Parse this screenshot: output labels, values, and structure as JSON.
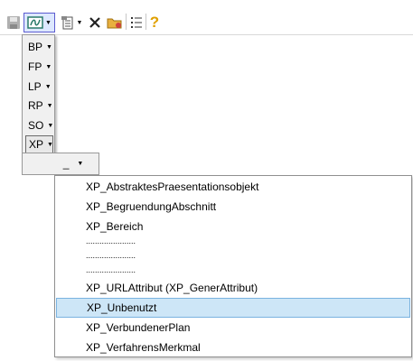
{
  "toolbar": {
    "buttons": [
      {
        "name": "save-icon"
      },
      {
        "name": "xplan-icon",
        "has_dropdown": true,
        "active": true
      },
      {
        "name": "properties-icon",
        "has_dropdown": true
      },
      {
        "name": "delete-icon"
      },
      {
        "name": "folder-icon"
      },
      {
        "name": "list-icon"
      },
      {
        "name": "help-icon",
        "glyph": "?"
      }
    ]
  },
  "menu": {
    "items": [
      {
        "label": "BP"
      },
      {
        "label": "FP"
      },
      {
        "label": "LP"
      },
      {
        "label": "RP"
      },
      {
        "label": "SO"
      },
      {
        "label": "XP",
        "active": true
      }
    ]
  },
  "submenu": {
    "label": "_"
  },
  "dropdown": {
    "items": [
      "XP_AbstraktesPraesentationsobjekt",
      "XP_BegruendungAbschnitt",
      "XP_Bereich",
      "......................",
      "......................",
      "......................",
      "XP_URLAttribut (XP_GenerAttribut)",
      "XP_Unbenutzt",
      "XP_VerbundenerPlan",
      "XP_VerfahrensMerkmal"
    ],
    "selected_index": 7
  },
  "colors": {
    "selection_bg": "#cde6f7",
    "selection_border": "#7ab3e0",
    "active_tool_border": "#5b5bd0",
    "help_icon": "#e0a000",
    "delete_icon": "#222222",
    "folder_icon": "#e8b040"
  }
}
